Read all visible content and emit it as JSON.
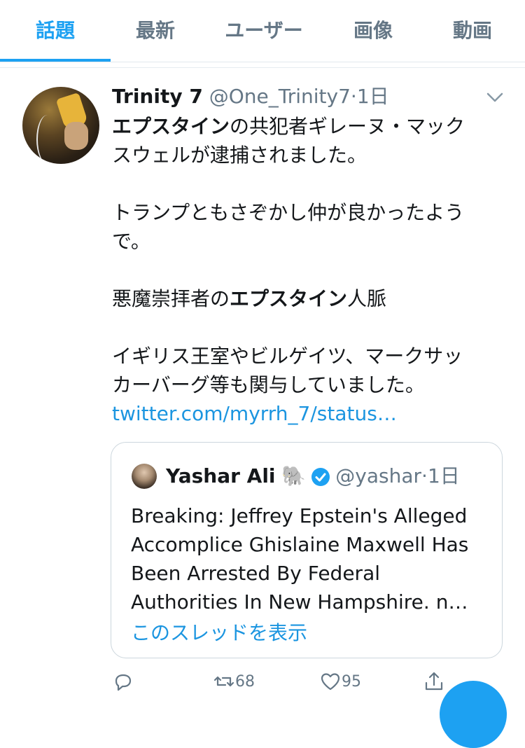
{
  "tabs": [
    {
      "label": "話題",
      "active": true
    },
    {
      "label": "最新",
      "active": false
    },
    {
      "label": "ユーザー",
      "active": false
    },
    {
      "label": "画像",
      "active": false
    },
    {
      "label": "動画",
      "active": false
    }
  ],
  "tweet": {
    "name": "Trinity 7",
    "handle": "@One_Trinity7",
    "dot": "·",
    "time": "1日",
    "line1_bold": "エプスタイン",
    "line1_rest": "の共犯者ギレーヌ・マック",
    "line2": "スウェルが逮捕されました。",
    "para2_line1": "トランプともさぞかし仲が良かったよう",
    "para2_line2": "で。",
    "para3_pre": "悪魔崇拝者の",
    "para3_bold": "エプスタイン",
    "para3_post": "人脈",
    "para4_line1": "イギリス王室やビルゲイツ、マークサッ",
    "para4_line2": "カーバーグ等も関与していました。",
    "link": "twitter.com/myrrh_7/status…"
  },
  "quote": {
    "name": "Yashar Ali",
    "emoji": "🐘",
    "handle": "@yashar",
    "dot": "·",
    "time": "1日",
    "text_lines": [
      "Breaking: Jeffrey Epstein's Alleged",
      "Accomplice Ghislaine Maxwell Has",
      "Been Arrested By Federal",
      "Authorities In New Hampshire. n…"
    ],
    "thread_link": "このスレッドを表示"
  },
  "actions": {
    "retweet_count": "68",
    "like_count": "95"
  },
  "colors": {
    "accent": "#1da1f2",
    "link": "#1b95e0",
    "muted": "#657786"
  }
}
